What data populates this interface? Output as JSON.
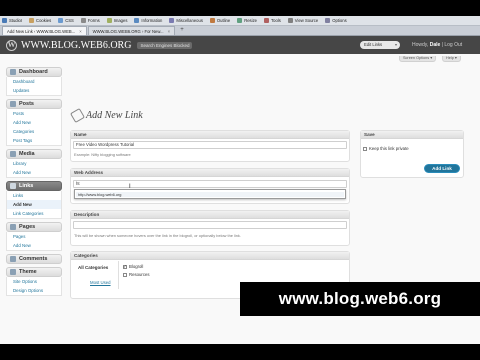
{
  "browser": {
    "toolbar": [
      {
        "label": "StudioI",
        "icon": "studio-icon",
        "color": "#4a7bb7"
      },
      {
        "label": "Cookies",
        "icon": "cookie-icon",
        "color": "#c8a060"
      },
      {
        "label": "CSS",
        "icon": "css-icon",
        "color": "#6a9ad0"
      },
      {
        "label": "Forms",
        "icon": "forms-icon",
        "color": "#8a8a8a"
      },
      {
        "label": "Images",
        "icon": "images-icon",
        "color": "#a0b060"
      },
      {
        "label": "Information",
        "icon": "info-icon",
        "color": "#5a8ac0"
      },
      {
        "label": "Miscellaneous",
        "icon": "misc-icon",
        "color": "#7a7ab0"
      },
      {
        "label": "Outline",
        "icon": "outline-icon",
        "color": "#c07a40"
      },
      {
        "label": "Resize",
        "icon": "resize-icon",
        "color": "#60a080"
      },
      {
        "label": "Tools",
        "icon": "tools-icon",
        "color": "#b06060"
      },
      {
        "label": "View Source",
        "icon": "view-source-icon",
        "color": "#808080"
      },
      {
        "label": "Options",
        "icon": "options-icon",
        "color": "#8080a0"
      }
    ],
    "tabs": [
      {
        "label": "Add New Link ‹ WWW.BLOG.WEB...",
        "active": true
      },
      {
        "label": "WWW.BLOG.WEB6.ORG › For New...",
        "active": false
      }
    ],
    "new_tab": "+"
  },
  "header": {
    "logo": "W",
    "site_title": "WWW.BLOG.WEB6.ORG",
    "visit_site": "Search Engines Blocked",
    "favorites": "Edit Links",
    "howdy": "Howdy,",
    "user": "Dale",
    "separator": "|",
    "logout": "Log Out",
    "screen_options": "Screen Options ▾",
    "help": "Help ▾"
  },
  "sidebar": [
    {
      "label": "Dashboard",
      "icon": "dashboard-icon",
      "current": false,
      "items": [
        {
          "label": "Dashboard",
          "current": false
        },
        {
          "label": "Updates",
          "current": false
        }
      ]
    },
    {
      "label": "Posts",
      "icon": "posts-icon",
      "current": false,
      "items": [
        {
          "label": "Posts",
          "current": false
        },
        {
          "label": "Add New",
          "current": false
        },
        {
          "label": "Categories",
          "current": false
        },
        {
          "label": "Post Tags",
          "current": false
        }
      ]
    },
    {
      "label": "Media",
      "icon": "media-icon",
      "current": false,
      "items": [
        {
          "label": "Library",
          "current": false
        },
        {
          "label": "Add New",
          "current": false
        }
      ]
    },
    {
      "label": "Links",
      "icon": "links-icon",
      "current": true,
      "items": [
        {
          "label": "Links",
          "current": false
        },
        {
          "label": "Add New",
          "current": true
        },
        {
          "label": "Link Categories",
          "current": false
        }
      ]
    },
    {
      "label": "Pages",
      "icon": "pages-icon",
      "current": false,
      "items": [
        {
          "label": "Pages",
          "current": false
        },
        {
          "label": "Add New",
          "current": false
        }
      ]
    },
    {
      "label": "Comments",
      "icon": "comments-icon",
      "current": false,
      "items": []
    },
    {
      "label": "Theme",
      "icon": "theme-icon",
      "current": false,
      "items": [
        {
          "label": "Site Options",
          "current": false
        },
        {
          "label": "Design Options",
          "current": false
        }
      ]
    }
  ],
  "main": {
    "title": "Add New Link",
    "name_box": {
      "heading": "Name",
      "value": "Free Video Wordpress Tutorial",
      "hint": "Example: Nifty blogging software"
    },
    "address_box": {
      "heading": "Web Address",
      "value": "ht",
      "autocomplete": "http://www.blog.web6.org"
    },
    "description_box": {
      "heading": "Description",
      "value": "",
      "hint": "This will be shown when someone hovers over the link in the blogroll, or optionally below the link."
    },
    "categories_box": {
      "heading": "Categories",
      "tab_all": "All Categories",
      "tab_most_used": "Most Used",
      "items": [
        {
          "label": "Blogroll",
          "checked": true
        },
        {
          "label": "Resources",
          "checked": false
        }
      ]
    }
  },
  "save_box": {
    "heading": "Save",
    "private_label": "Keep this link private",
    "private_checked": false,
    "add_button": "Add Link"
  },
  "watermark": "www.blog.web6.org",
  "colors": {
    "admin_header": "#464646",
    "link": "#21759b",
    "primary_button": "#21759b",
    "watermark_bg": "#000000"
  }
}
